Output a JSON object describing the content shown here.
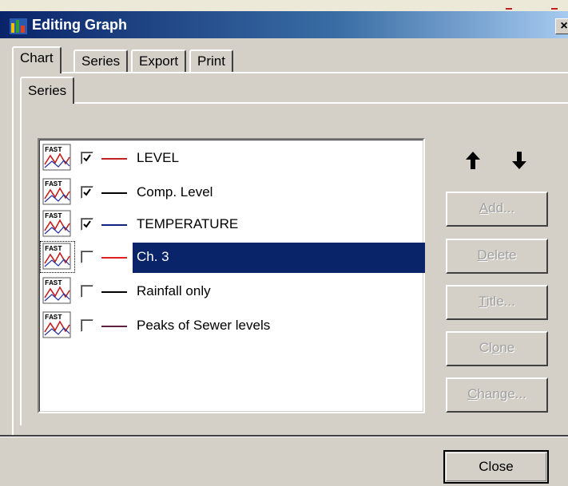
{
  "window": {
    "title": "Editing Graph",
    "close_glyph": "×"
  },
  "tabs": [
    {
      "label": "Chart",
      "active": true
    },
    {
      "label": "Series"
    },
    {
      "label": "Export"
    },
    {
      "label": "Print"
    }
  ],
  "inner_tab": {
    "label": "Series"
  },
  "series": [
    {
      "name": "LEVEL",
      "checked": true,
      "color": "#c02020",
      "icon": "fast-line-icon"
    },
    {
      "name": "Comp. Level",
      "checked": true,
      "color": "#000000",
      "icon": "fast-line-icon"
    },
    {
      "name": "TEMPERATURE",
      "checked": true,
      "color": "#102080",
      "icon": "fast-line-icon"
    },
    {
      "name": "Ch. 3",
      "checked": false,
      "color": "#e02020",
      "selected": true,
      "icon": "fast-line-icon"
    },
    {
      "name": "Rainfall only",
      "checked": false,
      "color": "#000000",
      "icon": "fast-line-icon"
    },
    {
      "name": "Peaks of Sewer levels",
      "checked": false,
      "color": "#602040",
      "icon": "fast-line-icon"
    }
  ],
  "order_buttons": {
    "up_icon": "arrow-up-icon",
    "down_icon": "arrow-down-icon"
  },
  "buttons": {
    "add": {
      "accel": "A",
      "rest": "dd..."
    },
    "delete": {
      "accel": "D",
      "rest": "elete"
    },
    "title": {
      "accel": "T",
      "rest": "itle..."
    },
    "clone": {
      "pre": "Cl",
      "accel": "o",
      "rest": "ne"
    },
    "change": {
      "accel": "C",
      "rest": "hange..."
    }
  },
  "close_button": {
    "label": "Close"
  }
}
